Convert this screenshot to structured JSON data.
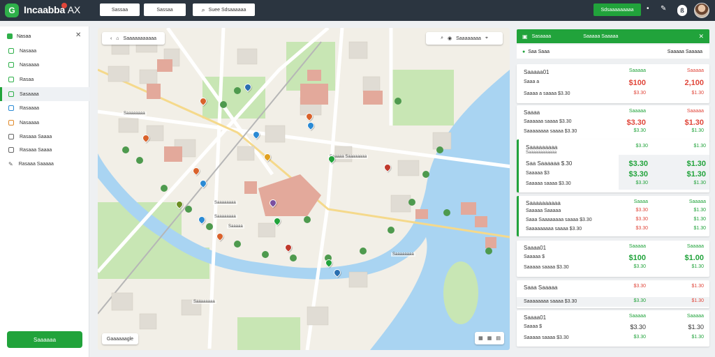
{
  "app": {
    "title": "Incaabba",
    "title_suffix": "AX",
    "logo_letter": "G"
  },
  "topbar": {
    "btn1": "Sassaa",
    "btn2": "Sassaa",
    "search_label": "Suee Sdsaaaaaa",
    "cta": "Sdsaaaaaaaaa"
  },
  "sidebar": {
    "header": "Nasaa",
    "items": [
      {
        "label": "Nasaaa"
      },
      {
        "label": "Nasaaaa"
      },
      {
        "label": "Rasaa"
      },
      {
        "label": "Sasaaaa",
        "active": true
      },
      {
        "label": "Rasaaaa"
      },
      {
        "label": "Nasaaaa"
      },
      {
        "label": "Rasaaa Saaaa"
      },
      {
        "label": "Rasaaa Saaaa"
      },
      {
        "label": "Rasaaa Saaaaa"
      }
    ],
    "footer_button": "Saaaaaa"
  },
  "map": {
    "breadcrumb": "Saaaaaaaaaaa",
    "search_placeholder": "Saaaaaaaa",
    "watermark": "Gaaaaaagle",
    "labels": [
      "Saaaaaaaa",
      "Saaaaa Saaaaaaaa",
      "Saaaaaaaa",
      "Saaaaaaaa",
      "Saaaaa",
      "Saaaaaaaa",
      "Saaaaaaaa"
    ]
  },
  "panel": {
    "header_left": "Sasaaaa",
    "header_right": "Saaaaa Saaaaa",
    "sub_left": "Saa Saaa",
    "sub_right": "Saaaaa Saaaaa",
    "cards": [
      {
        "title": "Saaaaa01",
        "col1_head": "Saaaaa",
        "col2_head": "Saaaaa",
        "rows": [
          {
            "label": "Saaa  a",
            "c1": "$100",
            "c2": "2,100"
          },
          {
            "label": "Saaaa a  saaaa  $3.30",
            "c1": "$3.30",
            "c2": "$1.30"
          }
        ]
      },
      {
        "title": "Saaaa",
        "col1_head": "Saaaaa",
        "col2_head": "Saaaaa",
        "rows": [
          {
            "label": "Saaaaaa  saaaa  $3.30",
            "c1": "$3.30",
            "c2": "$1.30"
          },
          {
            "label": "Saaaaaaaa  saaaa  $3.30",
            "c1": "$3.30",
            "c2": "$1.30"
          },
          {
            "label": "",
            "c1": "",
            "c2": ""
          }
        ]
      },
      {
        "title": "Saaaaaaaaa",
        "title_extra": "Saaaaaaaaaaaa",
        "col1_head": "$3.30",
        "col2_head": "$1.30",
        "rows": [
          {
            "label": "Saa Saaaaaa  $.30",
            "c1": "$3.30",
            "c2": "$1.30"
          },
          {
            "label": "Saaaaa  $3",
            "c1": "$3.30",
            "c2": "$1.30"
          },
          {
            "label": "Saaaaa  saaaa  $3.30",
            "c1": "$3.30",
            "c2": "$1.30"
          }
        ]
      },
      {
        "title": "Saaaaaaaaaa",
        "col1_head": "Saaaa",
        "col2_head": "Saaaaa",
        "rows": [
          {
            "label": "Saaaaa Saaaaa",
            "c1": "$3.30",
            "c2": "$1.30"
          },
          {
            "label": "Saaa  Saaaaaaaa  saaaa  $3.30",
            "c1": "$3.30",
            "c2": "$1.30"
          },
          {
            "label": "Saaaaaaaaa  saaaa  $3.30",
            "c1": "$3.30",
            "c2": "$1.30"
          }
        ]
      },
      {
        "title": "Saaaa01",
        "col1_head": "Saaaaa",
        "col2_head": "Saaaaa",
        "rows": [
          {
            "label": "Saaaaa  $",
            "c1": "$100",
            "c2": "$1.00"
          },
          {
            "label": "Saaaaa  saaaa  $3.30",
            "c1": "$3.30",
            "c2": "$1.30"
          }
        ]
      },
      {
        "title": "Saaa Saaaaa",
        "col1_head": "$3.30",
        "col2_head": "$1.30",
        "rows": [
          {
            "label": "Saaaaaaaa  saaaa  $3.30",
            "c1": "$3.30",
            "c2": "$1.30"
          }
        ]
      },
      {
        "title": "Saaaa01",
        "col1_head": "Saaaaa",
        "col2_head": "Saaaaa",
        "rows": [
          {
            "label": "Saaaa  $",
            "c1": "$3.30",
            "c2": "$1.30"
          },
          {
            "label": "Saaaaa  saaaa  $3.30",
            "c1": "$3.30",
            "c2": "$1.30"
          }
        ]
      }
    ]
  },
  "colors": {
    "brand": "#21a33b",
    "topbar": "#2b3540",
    "negative": "#e0463a",
    "water": "#a9d4f2",
    "park": "#c8e6b4"
  }
}
